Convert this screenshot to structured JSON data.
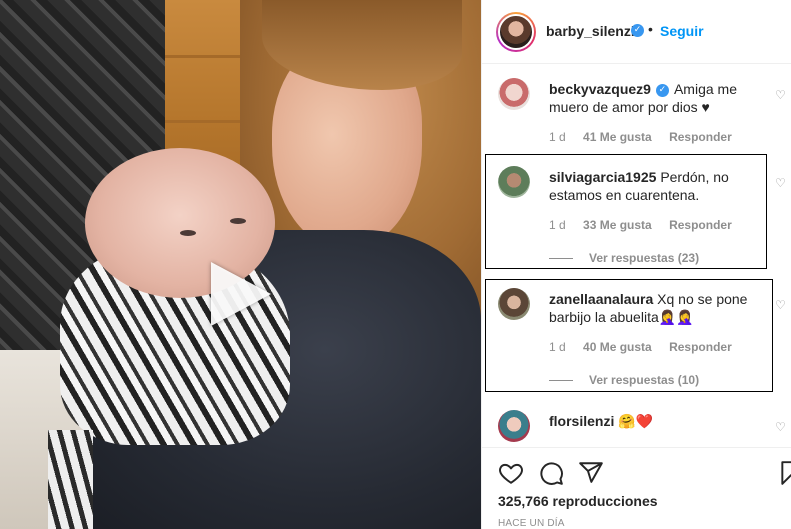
{
  "post": {
    "author": "barby_silenzi",
    "follow_label": "Seguir",
    "separator": "•",
    "views": "325,766 reproducciones",
    "time_ago": "HACE UN DÍA"
  },
  "comments": [
    {
      "user": "beckyvazquez9",
      "verified": true,
      "text": "Amiga me muero de amor por dios ♥",
      "age": "1 d",
      "likes": "41 Me gusta",
      "reply": "Responder",
      "view_replies": ""
    },
    {
      "user": "silviagarcia1925",
      "verified": false,
      "text": "Perdón, no estamos en cuarentena.",
      "age": "1 d",
      "likes": "33 Me gusta",
      "reply": "Responder",
      "view_replies": "Ver respuestas (23)"
    },
    {
      "user": "zanellaanalaura",
      "verified": false,
      "text": "Xq no se pone barbijo la abuelita🤦‍♀️🤦‍♀️",
      "age": "1 d",
      "likes": "40 Me gusta",
      "reply": "Responder",
      "view_replies": "Ver respuestas (10)"
    },
    {
      "user": "florsilenzi",
      "verified": false,
      "text": "🤗❤️",
      "age": "",
      "likes": "",
      "reply": "",
      "view_replies": ""
    }
  ],
  "icons": {
    "like": "heart-icon",
    "comment": "comment-icon",
    "share": "share-icon",
    "save": "bookmark-icon",
    "play": "play-icon",
    "verified": "verified-badge-icon"
  },
  "colors": {
    "accent": "#0095f6",
    "verified": "#3897f0",
    "muted": "#8e8e8e"
  }
}
